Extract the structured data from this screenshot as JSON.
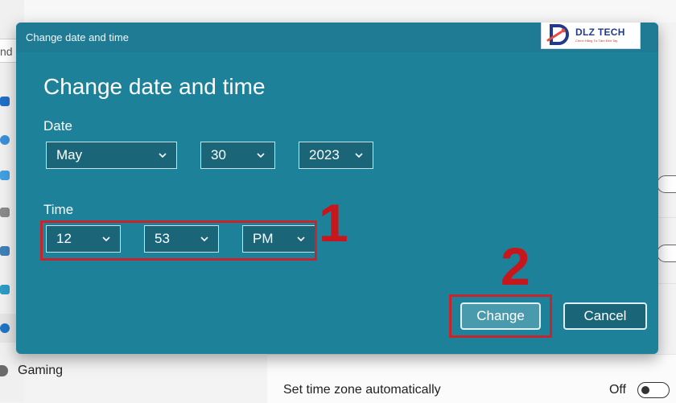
{
  "background": {
    "search_fragment": "nd",
    "sidebar_gaming": "Gaming",
    "row_label": "Set time zone automatically",
    "row_state": "Off"
  },
  "dialog": {
    "title": "Change date and time",
    "heading": "Change date and time",
    "date_label": "Date",
    "month": "May",
    "day": "30",
    "year": "2023",
    "time_label": "Time",
    "hour": "12",
    "minute": "53",
    "ampm": "PM",
    "change_button": "Change",
    "cancel_button": "Cancel"
  },
  "logo": {
    "name": "DLZ TECH",
    "tagline": "Chính Hãng Từ Tâm Đến Tay"
  },
  "annotations": {
    "step1": "1",
    "step2": "2",
    "color": "#c8161d"
  },
  "colors": {
    "dialog_bg": "#1c8199",
    "titlebar": "#1f7a93",
    "field_bg": "#1b6579",
    "accent_button": "#4a9aad"
  }
}
